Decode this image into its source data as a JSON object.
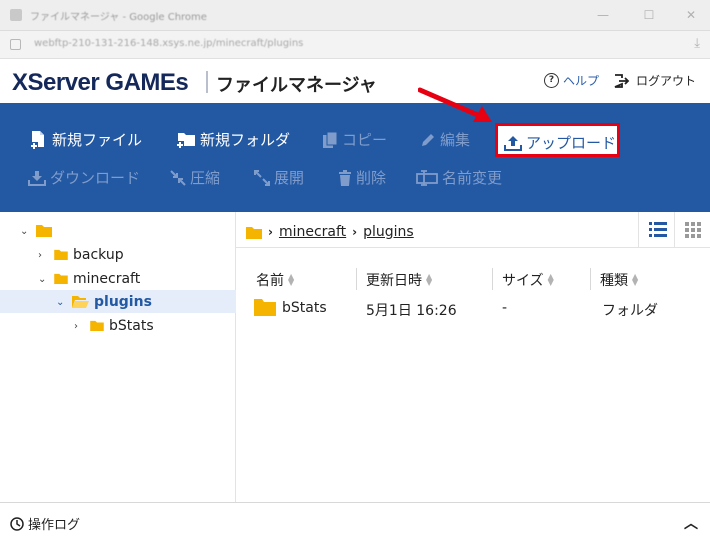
{
  "browser": {
    "title": "ファイルマネージャ - Google Chrome",
    "url": "webftp-210-131-216-148.xsys.ne.jp/minecraft/plugins"
  },
  "header": {
    "brand": "XServer GAMEs",
    "app_name": "ファイルマネージャ",
    "help_label": "ヘルプ",
    "logout_label": "ログアウト"
  },
  "toolbar": {
    "new_file": "新規ファイル",
    "new_folder": "新規フォルダ",
    "copy": "コピー",
    "edit": "編集",
    "upload": "アップロード",
    "download": "ダウンロード",
    "compress": "圧縮",
    "extract": "展開",
    "delete": "削除",
    "rename": "名前変更"
  },
  "tree": {
    "items": [
      {
        "label": "",
        "level": 0
      },
      {
        "label": "backup",
        "level": 1
      },
      {
        "label": "minecraft",
        "level": 1
      },
      {
        "label": "plugins",
        "level": 2,
        "selected": true
      },
      {
        "label": "bStats",
        "level": 3
      }
    ]
  },
  "breadcrumb": {
    "items": [
      "minecraft",
      "plugins"
    ]
  },
  "table": {
    "columns": [
      "名前",
      "更新日時",
      "サイズ",
      "種類"
    ],
    "rows": [
      {
        "name": "bStats",
        "modified": "5月1日 16:26",
        "size": "-",
        "type": "フォルダ"
      }
    ]
  },
  "footer": {
    "log_label": "操作ログ"
  },
  "colors": {
    "toolbar_bg": "#2358a3",
    "highlight": "#e60012",
    "folder": "#f5b400",
    "selected_bg": "#e4edf9"
  }
}
